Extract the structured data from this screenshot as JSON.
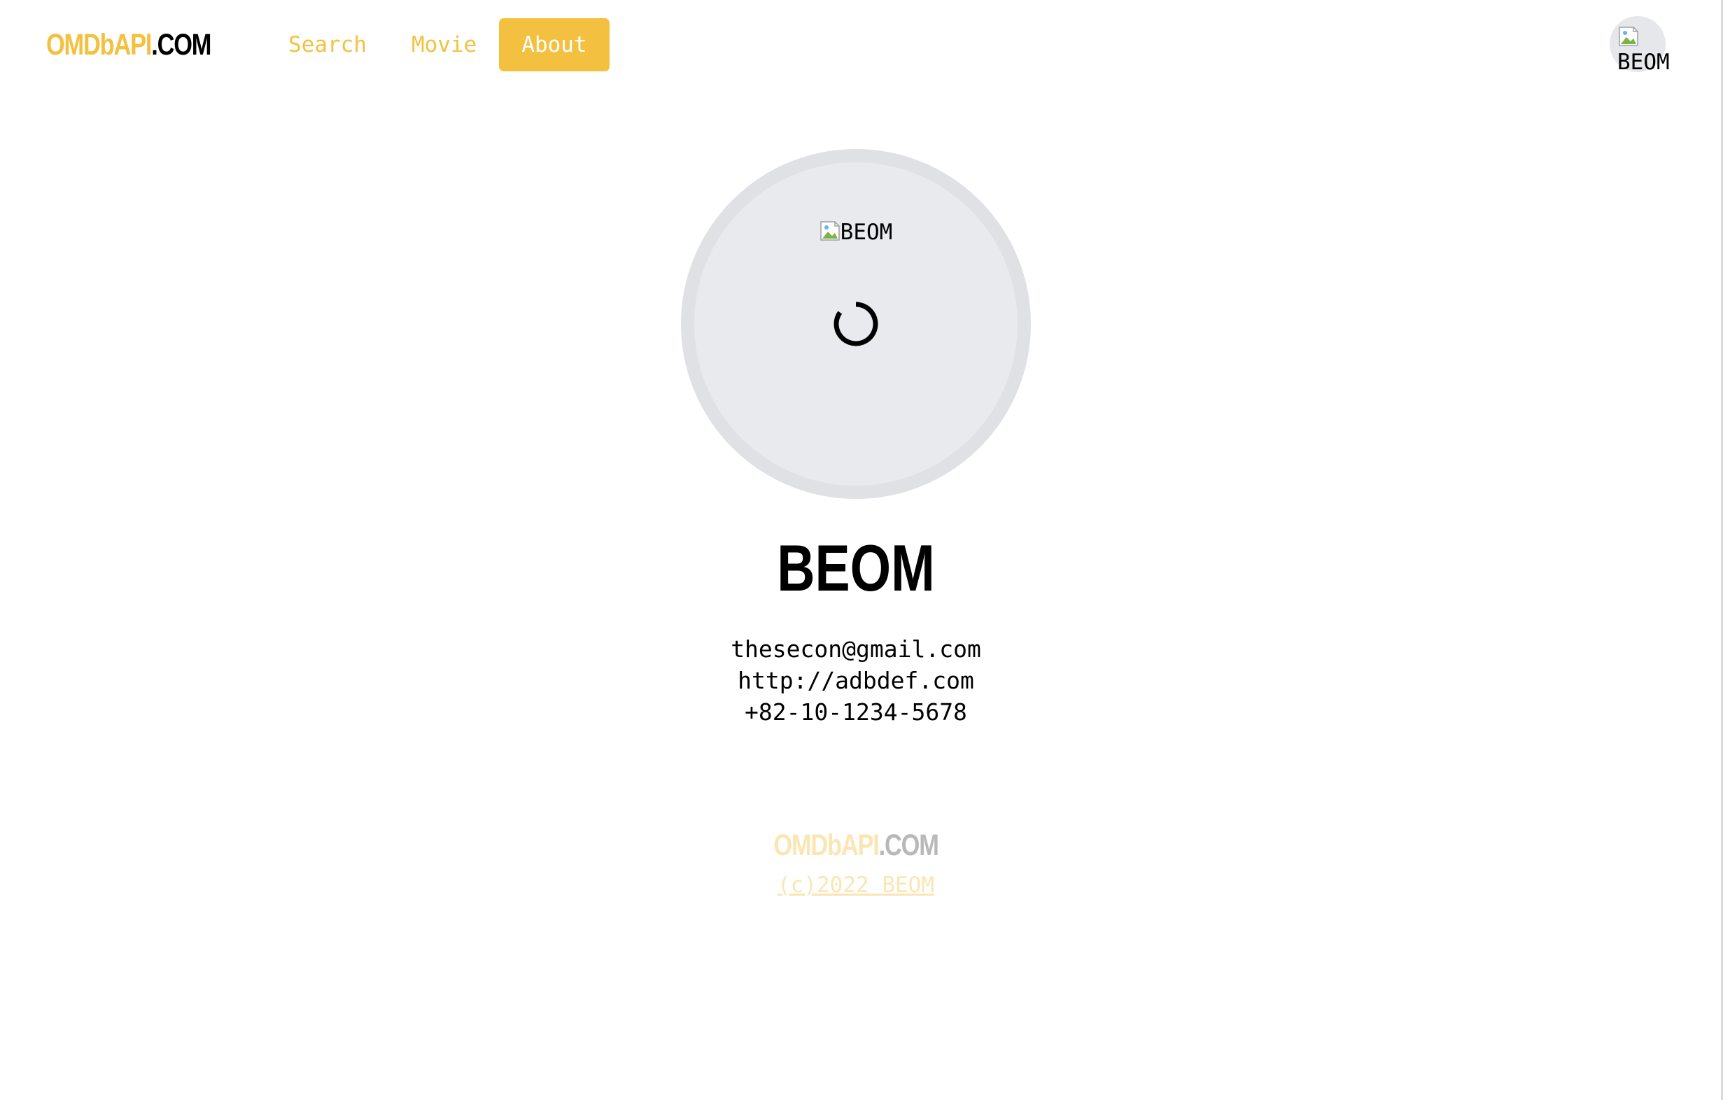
{
  "header": {
    "logo": {
      "part_a": "OMDbAPI",
      "part_b": ".COM"
    },
    "nav": [
      {
        "label": "Search",
        "active": false
      },
      {
        "label": "Movie",
        "active": false
      },
      {
        "label": "About",
        "active": true
      }
    ],
    "user_avatar_alt": "BEOM"
  },
  "profile": {
    "photo_alt": "BEOM",
    "loading": true,
    "name": "BEOM",
    "email": "thesecon@gmail.com",
    "website": "http://adbdef.com",
    "phone": "+82-10-1234-5678"
  },
  "footer": {
    "logo": {
      "part_a": "OMDbAPI",
      "part_b": ".COM"
    },
    "copyright": "(c)2022 BEOM"
  },
  "colors": {
    "accent": "#f4c03f",
    "accent_faded": "#fbe6b3",
    "avatar_bg": "#e9eaed",
    "avatar_border": "#dfe1e5",
    "text": "#000000"
  },
  "icons": {
    "broken_image": "broken-image-icon",
    "spinner": "loading-spinner-icon"
  }
}
